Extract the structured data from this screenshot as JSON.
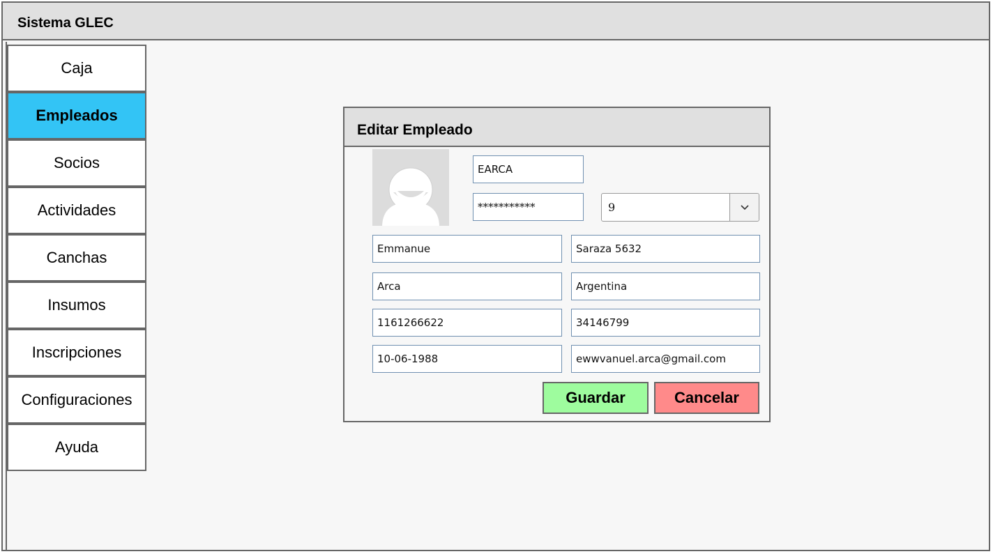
{
  "app": {
    "title": "Sistema GLEC"
  },
  "sidebar": {
    "items": [
      {
        "label": "Caja",
        "active": false
      },
      {
        "label": "Empleados",
        "active": true
      },
      {
        "label": "Socios",
        "active": false
      },
      {
        "label": "Actividades",
        "active": false
      },
      {
        "label": "Canchas",
        "active": false
      },
      {
        "label": "Insumos",
        "active": false
      },
      {
        "label": "Inscripciones",
        "active": false
      },
      {
        "label": "Configuraciones",
        "active": false
      },
      {
        "label": "Ayuda",
        "active": false
      }
    ]
  },
  "dialog": {
    "title": "Editar Empleado",
    "avatar_icon": "user-avatar-icon",
    "username": "EARCA",
    "password": "***********",
    "level_select": {
      "value": "9",
      "icon": "chevron-down-icon"
    },
    "nombre": "Emmanue",
    "direccion": "Saraza 5632",
    "apellido": "Arca",
    "pais": "Argentina",
    "telefono": "1161266622",
    "dni": "34146799",
    "fecha_nacimiento": "10-06-1988",
    "email": "ewwvanuel.arca@gmail.com",
    "save_label": "Guardar",
    "cancel_label": "Cancelar"
  },
  "colors": {
    "active_nav": "#33c4f5",
    "save_button": "#9efc9e",
    "cancel_button": "#ff8a8a",
    "header_bg": "#e0e0e0"
  }
}
